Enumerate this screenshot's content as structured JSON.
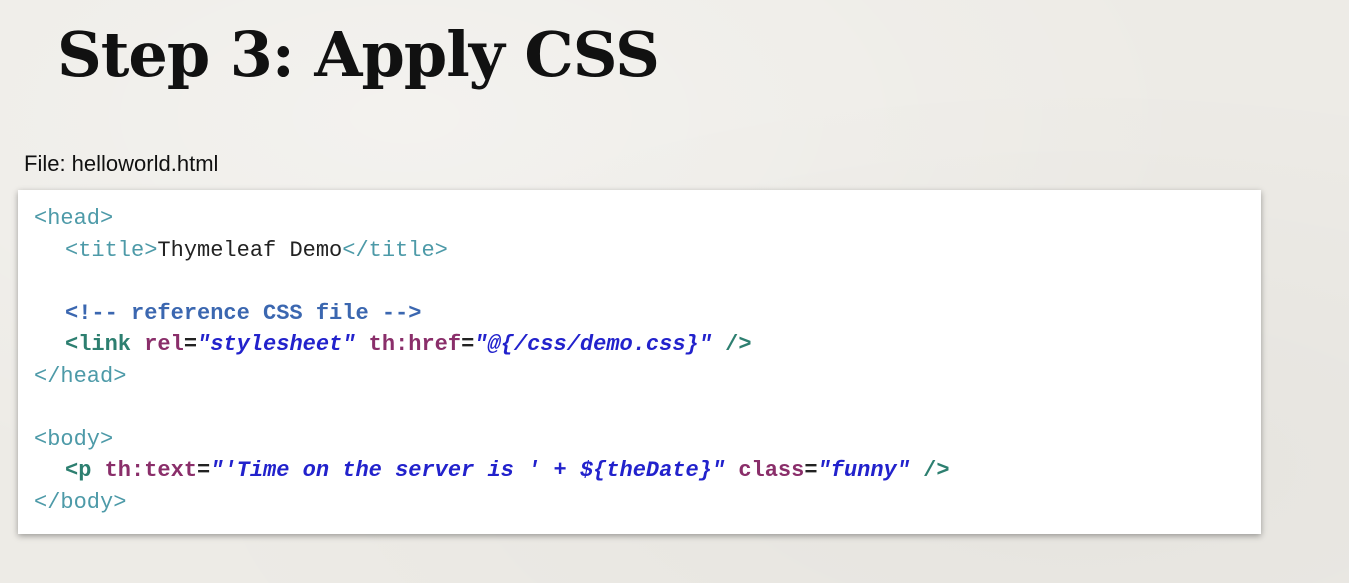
{
  "slide": {
    "title": "Step 3: Apply CSS",
    "file_label": "File: helloworld.html"
  },
  "code": {
    "line1": {
      "open_head": "<head>"
    },
    "line2": {
      "open_title": "<title>",
      "title_text": "Thymeleaf Demo",
      "close_title": "</title>"
    },
    "line4": {
      "comment": "<!-- reference CSS file -->"
    },
    "line5": {
      "tag": "<link",
      "attr1": "rel",
      "eq1": "=",
      "val1": "\"stylesheet\"",
      "attr2": "th:href",
      "eq2": "=",
      "val2": "\"@{/css/demo.css}\"",
      "close": "/>"
    },
    "line6": {
      "close_head": "</head>"
    },
    "line8": {
      "open_body": "<body>"
    },
    "line9": {
      "tag": "<p",
      "attr1": "th:text",
      "eq1": "=",
      "val1": "\"'Time on the server is ' + ${theDate}\"",
      "attr2": "class",
      "eq2": "=",
      "val2": "\"funny\"",
      "close": "/>"
    },
    "line10": {
      "close_body": "</body>"
    }
  }
}
